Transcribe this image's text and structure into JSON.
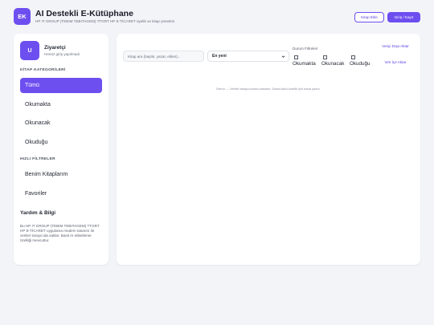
{
  "header": {
    "logo_text": "EK",
    "title": "AI Destekli E-Kütüphane",
    "subtitle": "HP IT GROUP (TEBIM TEBITAGEM) TTGRT HP E-TİCARET üyelik ve kitap yönetimi",
    "add_book_label": "Kitap Ekle",
    "login_label": "Giriş / Kayıt"
  },
  "sidebar": {
    "avatar_text": "U",
    "user_name": "Ziyaretçi",
    "user_status": "Henüz giriş yapılmadı",
    "categories_heading": "KİTAP KATEGORİLERİ",
    "categories": [
      {
        "label": "Tümü",
        "active": true
      },
      {
        "label": "Okumakta",
        "active": false
      },
      {
        "label": "Okunacak",
        "active": false
      },
      {
        "label": "Okuduğu",
        "active": false
      }
    ],
    "quick_heading": "HIZLI FİLTRELER",
    "quick_filters": [
      {
        "label": "Benim Kitaplarım"
      },
      {
        "label": "Favoriler"
      }
    ],
    "help_heading": "Yardım & Bilgi",
    "help_text": "Bu HP IT GROUP (TEBIM TEBITAGEM) TTGRT HP E-TİCARET uygulama modern tasarım ile verileri tarayıcıda saklar. Basit AI etiketleme özelliği mevcuttur."
  },
  "main": {
    "search_placeholder": "Kitap ara (başlık, yazar, etiket)...",
    "sort_value": "En yeni",
    "filters_heading": "Durum Filtreleri",
    "filters": [
      {
        "label": "Okumakta",
        "checked": false
      },
      {
        "label": "Okunacak",
        "checked": false
      },
      {
        "label": "Okuduğu",
        "checked": false
      }
    ],
    "export_label": "Veriyi Dışa Aktar",
    "import_label": "Veri İçe Aktar",
    "demo_note": "Demo — Veriler tarayıcınızda saklanır. Daha fazla özellik için bana yazın."
  },
  "colors": {
    "accent": "#6d4ff0",
    "background": "#f3f4f8",
    "card": "#ffffff"
  }
}
